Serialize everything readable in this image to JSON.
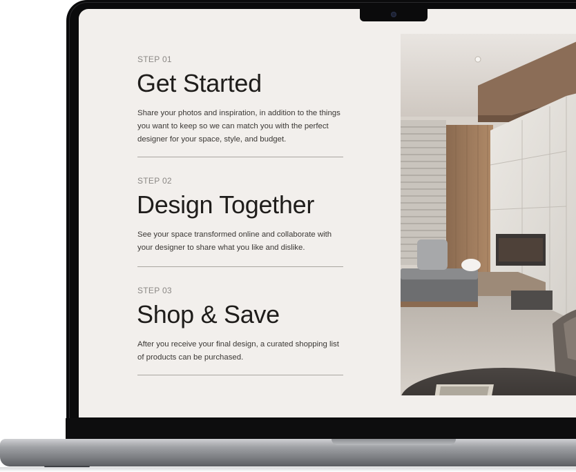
{
  "steps": [
    {
      "label": "STEP 01",
      "title": "Get Started",
      "description": "Share your photos and inspiration, in addition to the things you want to keep so we can match you with the perfect designer for your space, style, and budget."
    },
    {
      "label": "STEP 02",
      "title": "Design Together",
      "description": "See your space transformed online and collaborate with your designer to share what you like and dislike."
    },
    {
      "label": "STEP 03",
      "title": "Shop & Save",
      "description": "After you receive your final design, a curated shopping list of products can be purchased."
    }
  ],
  "colors": {
    "screen_background": "#f2efec",
    "title_text": "#1f1d1b",
    "label_text": "#8a8784",
    "divider": "#a9a5a0",
    "laptop_frame": "#0b0b0c",
    "laptop_base": "#9fa1a5"
  },
  "image": {
    "subject": "modern-living-room-photo"
  }
}
